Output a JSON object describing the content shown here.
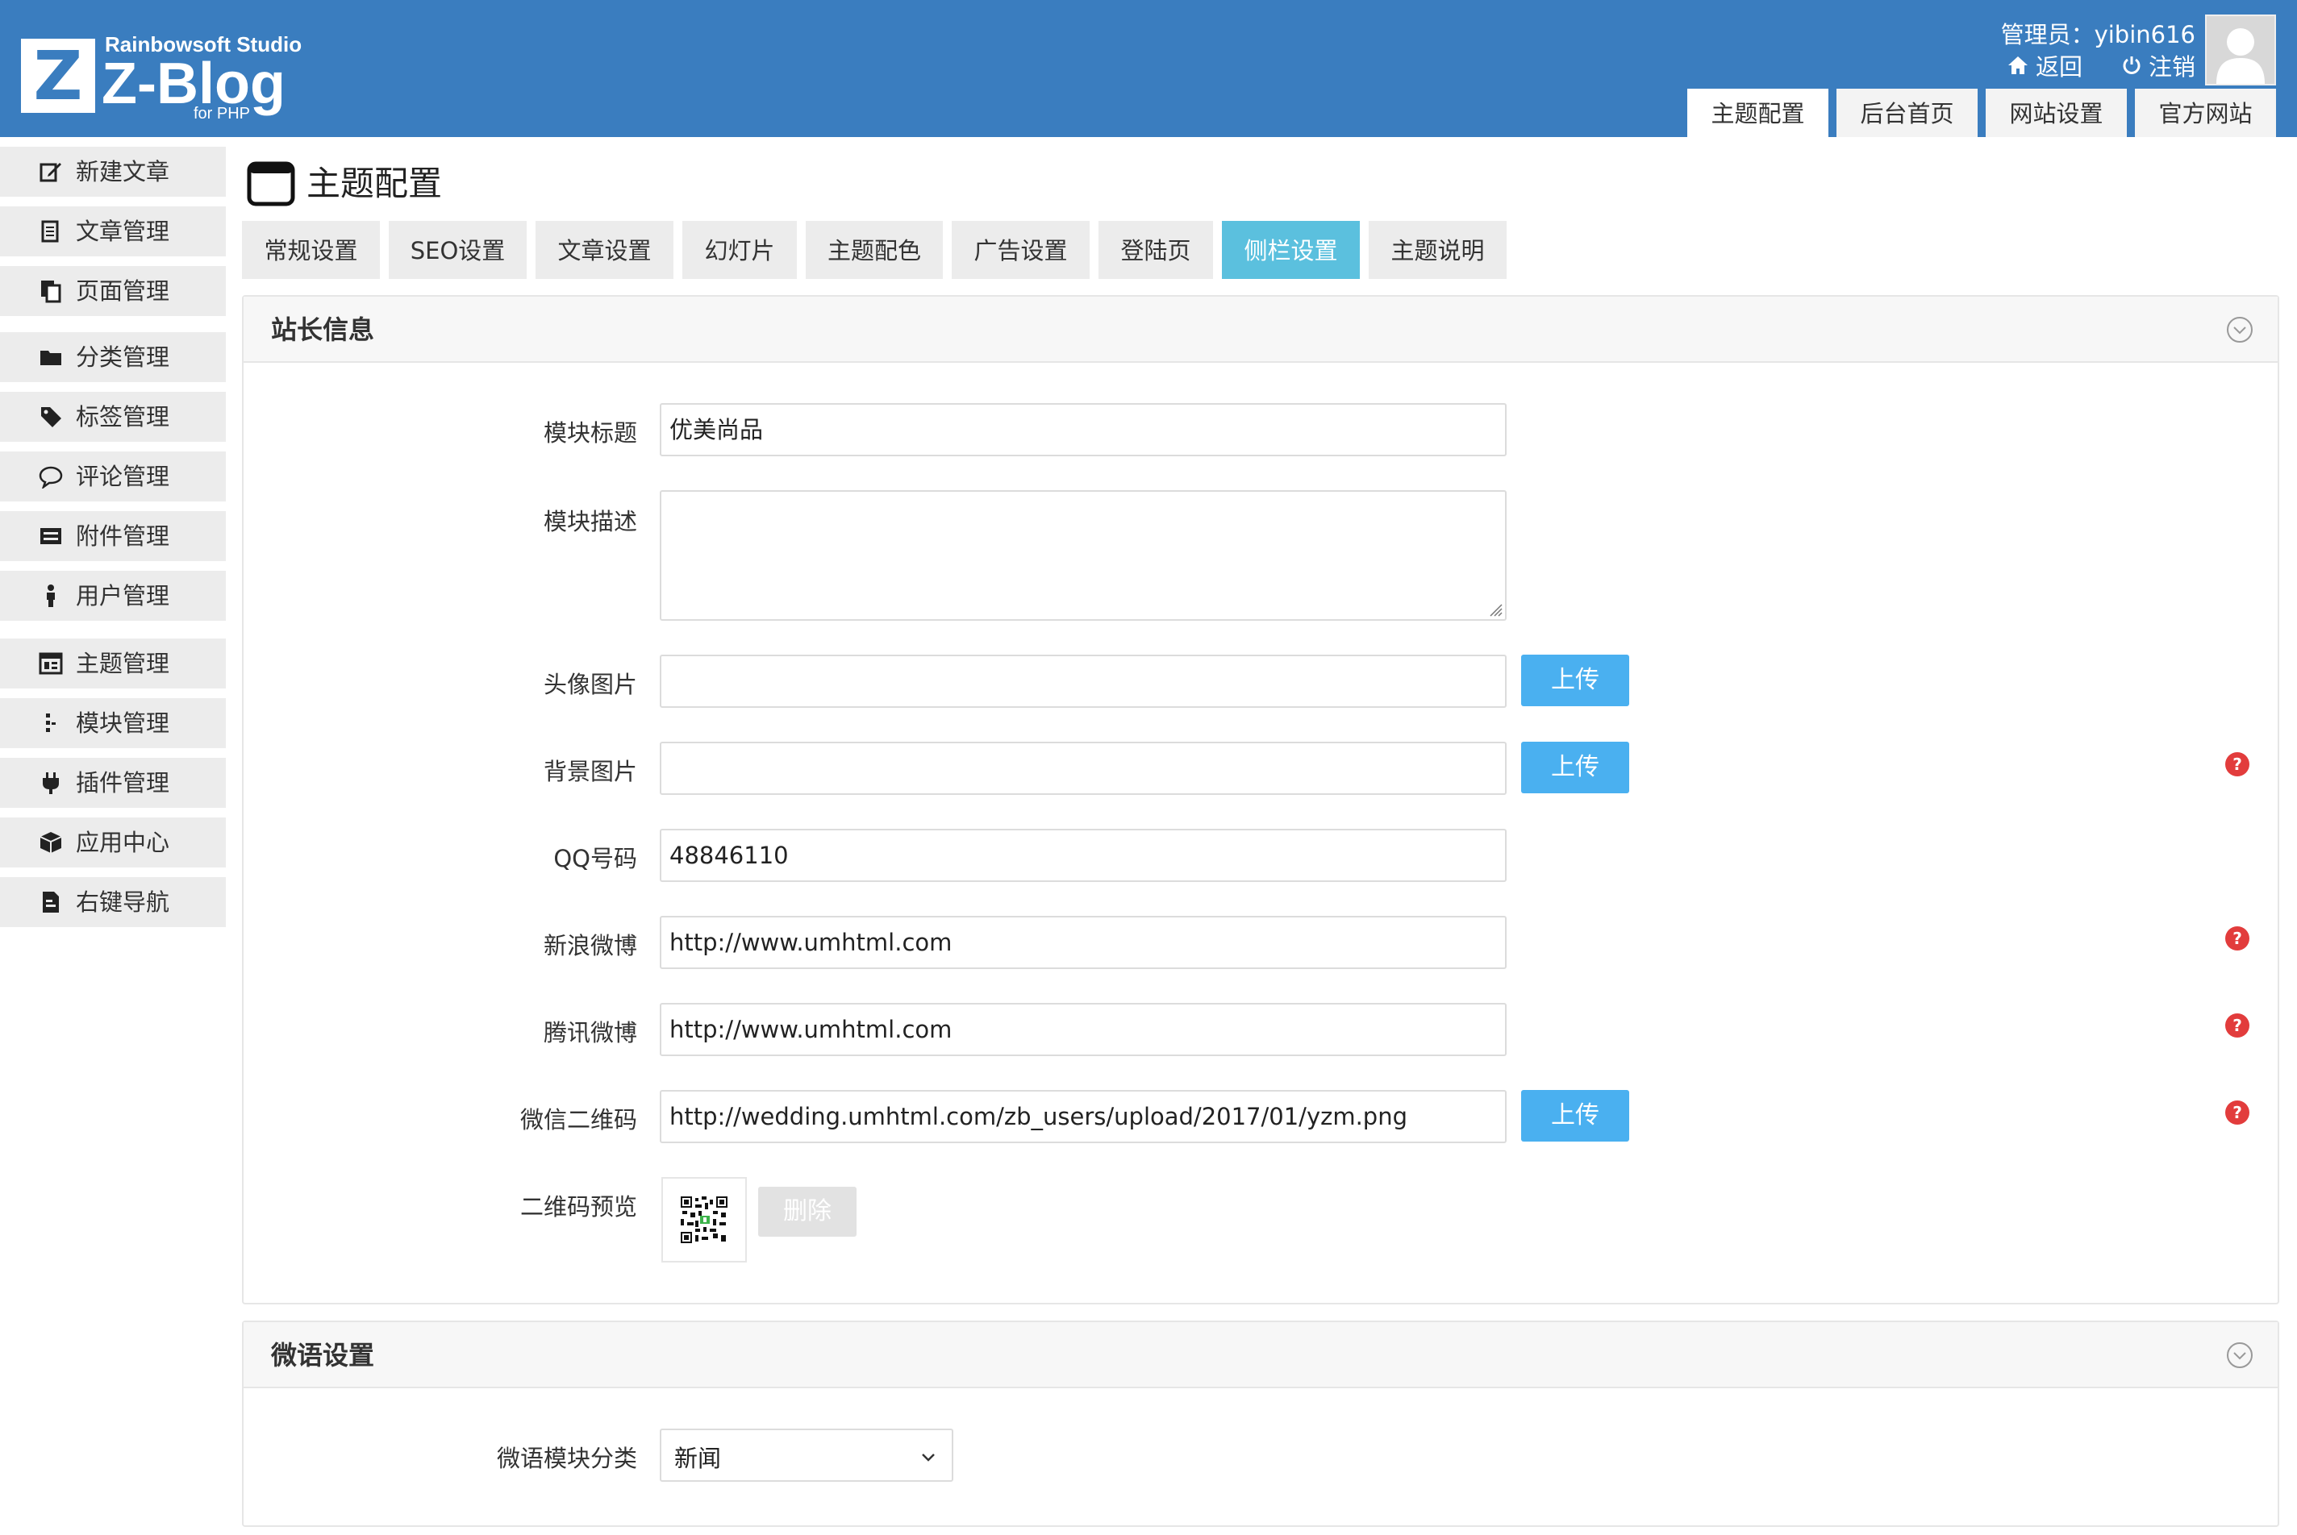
{
  "header": {
    "logo": {
      "letter": "Z",
      "studio": "Rainbowsoft Studio",
      "name": "Z-Blog",
      "sub": "for PHP"
    },
    "admin": "管理员：yibin616",
    "links": {
      "back": "返回",
      "logout": "注销"
    },
    "nav": [
      "主题配置",
      "后台首页",
      "网站设置",
      "官方网站"
    ],
    "active_nav": "主题配置"
  },
  "sidebar": {
    "items": [
      {
        "label": "新建文章",
        "icon": "edit-icon"
      },
      {
        "label": "文章管理",
        "icon": "article-icon"
      },
      {
        "label": "页面管理",
        "icon": "page-icon"
      },
      {
        "label": "分类管理",
        "icon": "folder-icon"
      },
      {
        "label": "标签管理",
        "icon": "tag-icon"
      },
      {
        "label": "评论管理",
        "icon": "comment-icon"
      },
      {
        "label": "附件管理",
        "icon": "attachment-icon"
      },
      {
        "label": "用户管理",
        "icon": "user-icon"
      },
      {
        "label": "主题管理",
        "icon": "theme-icon"
      },
      {
        "label": "模块管理",
        "icon": "module-icon"
      },
      {
        "label": "插件管理",
        "icon": "plugin-icon"
      },
      {
        "label": "应用中心",
        "icon": "app-center-icon"
      },
      {
        "label": "右键导航",
        "icon": "context-nav-icon"
      }
    ]
  },
  "main": {
    "title": "主题配置",
    "tabs": [
      "常规设置",
      "SEO设置",
      "文章设置",
      "幻灯片",
      "主题配色",
      "广告设置",
      "登陆页",
      "侧栏设置",
      "主题说明"
    ],
    "active_tab": "侧栏设置",
    "panel1": {
      "title": "站长信息",
      "fields": {
        "module_title": {
          "label": "模块标题",
          "value": "优美尚品"
        },
        "module_desc": {
          "label": "模块描述",
          "value": ""
        },
        "avatar": {
          "label": "头像图片",
          "value": ""
        },
        "background": {
          "label": "背景图片",
          "value": ""
        },
        "qq": {
          "label": "QQ号码",
          "value": "48846110"
        },
        "sina": {
          "label": "新浪微博",
          "value": "http://www.umhtml.com"
        },
        "tencent": {
          "label": "腾讯微博",
          "value": "http://www.umhtml.com"
        },
        "wechat_qr": {
          "label": "微信二维码",
          "value": "http://wedding.umhtml.com/zb_users/upload/2017/01/yzm.png"
        },
        "qr_preview": {
          "label": "二维码预览"
        }
      },
      "upload_label": "上传",
      "delete_label": "删除"
    },
    "panel2": {
      "title": "微语设置",
      "category_label": "微语模块分类",
      "category_value": "新闻"
    }
  },
  "colors": {
    "header_bg": "#3a7dbf",
    "active_tab": "#5bc0de",
    "upload_button": "#4ab0f0",
    "help_icon": "#e23c3c",
    "sidebar_bg": "#ececec"
  }
}
